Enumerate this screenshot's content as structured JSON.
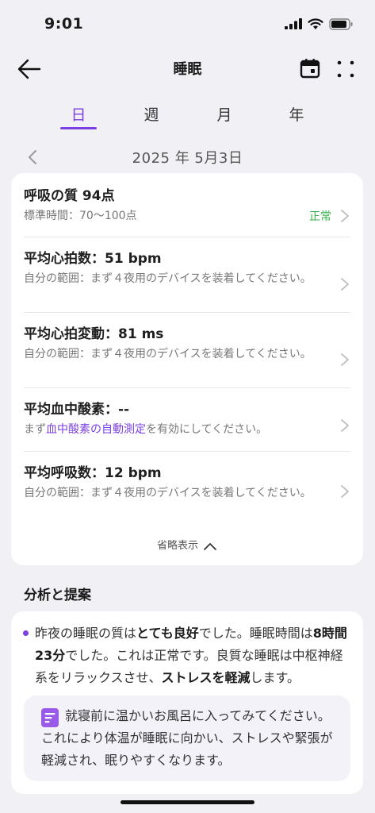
{
  "status_bar": {
    "time": "9:01"
  },
  "nav": {
    "title": "睡眠"
  },
  "tabs": [
    {
      "label": "日",
      "active": true
    },
    {
      "label": "週",
      "active": false
    },
    {
      "label": "月",
      "active": false
    },
    {
      "label": "年",
      "active": false
    }
  ],
  "date": "2025 年 5月3日",
  "metrics": [
    {
      "title": "呼吸の質 94点",
      "sub": "標準時間：70～100点",
      "status": "正常"
    },
    {
      "title": "平均心拍数：51 bpm",
      "sub": "自分の範囲：まず４夜用のデバイスを装着してください。"
    },
    {
      "title": "平均心拍変動：81 ms",
      "sub": "自分の範囲：まず４夜用のデバイスを装着してください。"
    },
    {
      "title": "平均血中酸素：--",
      "sub_prefix": "まず",
      "sub_link": "血中酸素の自動測定",
      "sub_suffix": "を有効にしてください。"
    },
    {
      "title": "平均呼吸数：12 bpm",
      "sub": "自分の範囲：まず４夜用のデバイスを装着してください。"
    }
  ],
  "collapse_label": "省略表示",
  "analysis": {
    "section_title": "分析と提案",
    "p1": "昨夜の睡眠の質は",
    "b1": "とても良好",
    "p2": "でした。睡眠時間は",
    "b2": "8時間23分",
    "p3": "でした。これは正常です。良質な睡眠は中枢神経系をリラックスさせ、",
    "b3": "ストレスを軽減",
    "p4": "します。",
    "tip": "就寝前に温かいお風呂に入ってみてください。これにより体温が睡眠に向かい、ストレスや緊張が軽減され、眠りやすくなります。"
  },
  "colors": {
    "accent": "#7b3fe4",
    "normal": "#36b24a"
  },
  "icons": [
    "back-arrow-icon",
    "calendar-icon",
    "more-icon",
    "chevron-left-icon",
    "chevron-right-icon",
    "chevron-up-icon",
    "note-icon"
  ]
}
